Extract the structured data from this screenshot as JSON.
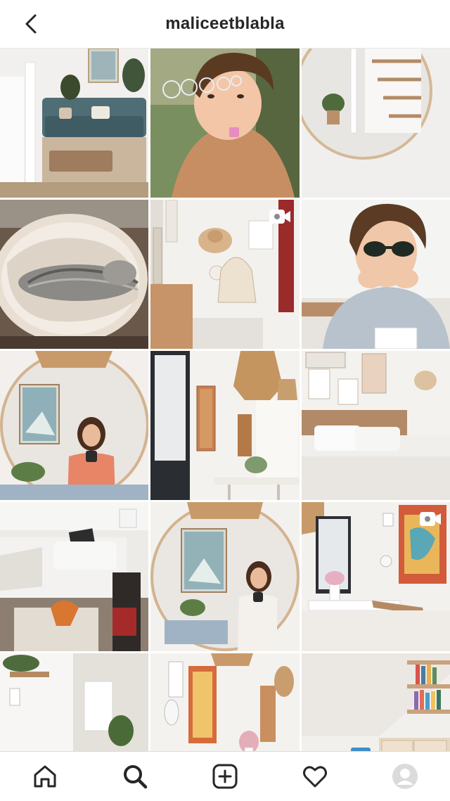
{
  "header": {
    "username": "maliceetblabla",
    "back_icon": "chevron-left-icon"
  },
  "grid": {
    "posts": [
      {
        "scene": "living-room-blue-sofa",
        "video": false
      },
      {
        "scene": "child-blowing-bubbles",
        "video": false
      },
      {
        "scene": "round-mirror-stairs",
        "video": false
      },
      {
        "scene": "cat-in-basket",
        "video": false
      },
      {
        "scene": "wall-hat-bag-curtain",
        "video": true
      },
      {
        "scene": "child-sunglasses",
        "video": false
      },
      {
        "scene": "mirror-selfie-pink-sweater",
        "video": false
      },
      {
        "scene": "pendant-lamps-window",
        "video": false
      },
      {
        "scene": "bedroom-wood-headboard",
        "video": false
      },
      {
        "scene": "white-sofa-pillows",
        "video": false
      },
      {
        "scene": "mirror-selfie-white-outfit",
        "video": false
      },
      {
        "scene": "dining-table-art",
        "video": true
      },
      {
        "scene": "shelf-bilbao-sign",
        "video": false
      },
      {
        "scene": "dining-chairs-mirror",
        "video": false
      },
      {
        "scene": "bookshelf-blue-chair",
        "video": false
      }
    ]
  },
  "tabbar": {
    "items": [
      "home-icon",
      "search-icon",
      "add-post-icon",
      "activity-heart-icon",
      "profile-avatar-icon"
    ],
    "active": "search-icon"
  },
  "colors": {
    "text": "#262626",
    "divider": "#dbdbdb",
    "background": "#ffffff"
  }
}
